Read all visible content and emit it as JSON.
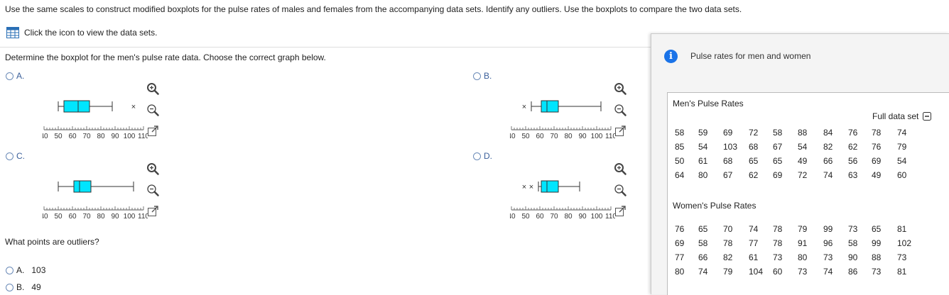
{
  "instructions": "Use the same scales to construct modified boxplots for the pulse rates of males and females from the accompanying data sets. Identify any outliers. Use the boxplots to compare the two data sets.",
  "view_data_link": "Click the icon to view the data sets.",
  "question": "Determine the boxplot for the men's pulse rate data. Choose the correct graph below.",
  "options": [
    {
      "label": "A.",
      "box": {
        "min": 50,
        "q1": 54,
        "median": 64,
        "q3": 72,
        "max": 88,
        "outliers": [
          103
        ]
      }
    },
    {
      "label": "B.",
      "box": {
        "min": 54,
        "q1": 61,
        "median": 65,
        "q3": 73,
        "max": 103,
        "outliers": [
          49
        ]
      }
    },
    {
      "label": "C.",
      "box": {
        "min": 50,
        "q1": 61,
        "median": 65,
        "q3": 73,
        "max": 103,
        "outliers": []
      }
    },
    {
      "label": "D.",
      "box": {
        "min": 59,
        "q1": 61,
        "median": 65,
        "q3": 73,
        "max": 88,
        "outliers": [
          49,
          54
        ]
      }
    }
  ],
  "axis_ticks": [
    "40",
    "50",
    "60",
    "70",
    "80",
    "90",
    "100",
    "110"
  ],
  "axis_range": [
    40,
    110
  ],
  "outlier_question": "What points are outliers?",
  "outlier_options": [
    {
      "label": "A.",
      "value": "103"
    },
    {
      "label": "B.",
      "value": "49"
    }
  ],
  "popup": {
    "title": "Pulse rates for men and women",
    "full_data_set": "Full data set",
    "men_title": "Men's Pulse Rates",
    "men_rows": [
      [
        "58",
        "59",
        "69",
        "72",
        "58",
        "88",
        "84",
        "76",
        "78",
        "74"
      ],
      [
        "85",
        "54",
        "103",
        "68",
        "67",
        "54",
        "82",
        "62",
        "76",
        "79"
      ],
      [
        "50",
        "61",
        "68",
        "65",
        "65",
        "49",
        "66",
        "56",
        "69",
        "54"
      ],
      [
        "64",
        "80",
        "67",
        "62",
        "69",
        "72",
        "74",
        "63",
        "49",
        "60"
      ]
    ],
    "women_title": "Women's Pulse Rates",
    "women_rows": [
      [
        "76",
        "65",
        "70",
        "74",
        "78",
        "79",
        "99",
        "73",
        "65",
        "81"
      ],
      [
        "69",
        "58",
        "78",
        "77",
        "78",
        "91",
        "96",
        "58",
        "99",
        "102"
      ],
      [
        "77",
        "66",
        "82",
        "61",
        "73",
        "80",
        "73",
        "90",
        "88",
        "73"
      ],
      [
        "80",
        "74",
        "79",
        "104",
        "60",
        "73",
        "74",
        "86",
        "73",
        "81"
      ]
    ]
  },
  "colors": {
    "box_fill": "#00e5ff",
    "accent": "#1a73e8",
    "link": "#3a5f9a"
  }
}
